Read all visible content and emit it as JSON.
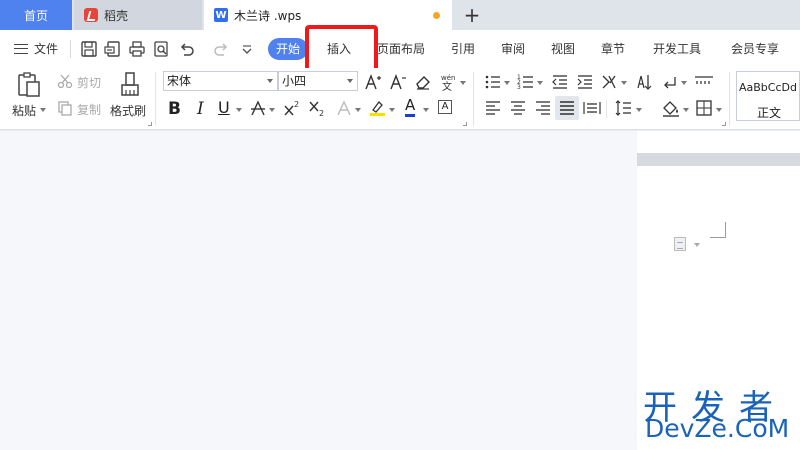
{
  "tabs": {
    "home": "首页",
    "daoke": "稻壳",
    "document": "木兰诗 .wps",
    "doc_logo_letter": "W",
    "new_tab": "+"
  },
  "menu": {
    "file": "文件",
    "items": [
      "开始",
      "插入",
      "页面布局",
      "引用",
      "审阅",
      "视图",
      "章节",
      "开发工具",
      "会员专享"
    ]
  },
  "ribbon": {
    "paste": "粘贴",
    "cut": "剪切",
    "copy": "复制",
    "format_painter": "格式刷",
    "font_name": "宋体",
    "font_size": "小四",
    "style_sample": "AaBbCcDd",
    "style_name": "正文",
    "bold": "B",
    "italic": "I",
    "underline": "U",
    "font_color": "A",
    "char_border": "A"
  },
  "watermark": {
    "cn": "开发者",
    "en": "DevZe.CoM"
  },
  "colors": {
    "accent": "#4f82ef",
    "highlight_box": "#f01818",
    "highlight_yellow": "#f5e000",
    "font_red": "#e02020",
    "font_blue": "#1a3fd6",
    "watermark": "#1a63b8"
  }
}
